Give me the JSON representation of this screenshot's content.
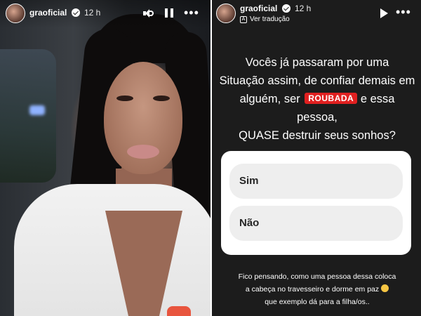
{
  "left_story": {
    "username": "graoficial",
    "time": "12 h",
    "more_icon": "more-horizontal-icon",
    "volume_icon": "speaker-icon",
    "pause_icon": "pause-icon"
  },
  "right_story": {
    "username": "graoficial",
    "time": "12 h",
    "translate_label": "Ver tradução",
    "question_line1": "Vocês já passaram por uma",
    "question_line2": "Situação assim,  de confiar demais em",
    "question_line3_before": "alguém, ser",
    "question_badge": "ROUBADA",
    "question_line3_after": "e essa pessoa,",
    "question_line4": "QUASE destruir seus sonhos?",
    "poll_options": [
      "Sim",
      "Não"
    ],
    "footer_line1": "Fico pensando, como uma pessoa dessa coloca",
    "footer_line2": "a cabeça no travesseiro e dorme em paz",
    "footer_line3": "que exemplo dá para a filha/os..",
    "colors": {
      "badge": "#e02020",
      "story_bg": "#1c1c1c",
      "poll_bg": "#ffffff",
      "option_bg": "#eeeeee"
    }
  }
}
